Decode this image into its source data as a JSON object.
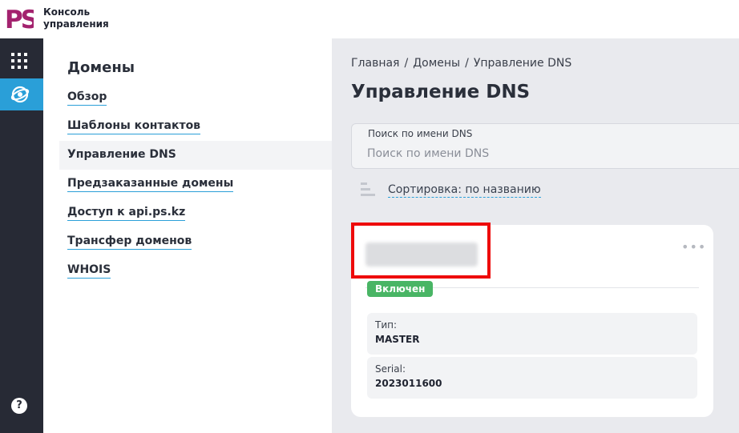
{
  "header": {
    "logo_line1": "Консоль",
    "logo_line2": "управления",
    "logo_mark": "PS",
    "brand_color": "#a3226e"
  },
  "rail": {
    "apps_icon": "grid-icon",
    "active_icon": "globe-icon",
    "help_label": "?",
    "active_color": "#2a9fd8"
  },
  "subnav": {
    "title": "Домены",
    "items": [
      {
        "label": "Обзор",
        "active": false
      },
      {
        "label": "Шаблоны контактов",
        "active": false
      },
      {
        "label": "Управление DNS",
        "active": true
      },
      {
        "label": "Предзаказанные домены",
        "active": false
      },
      {
        "label": "Доступ к api.ps.kz",
        "active": false
      },
      {
        "label": "Трансфер доменов",
        "active": false
      },
      {
        "label": "WHOIS",
        "active": false
      }
    ]
  },
  "main": {
    "breadcrumb": [
      "Главная",
      "Домены",
      "Управление DNS"
    ],
    "breadcrumb_sep": "/",
    "title": "Управление DNS",
    "search": {
      "label": "Поиск по имени DNS",
      "placeholder": "Поиск по имени DNS",
      "value": ""
    },
    "sort": {
      "label": "Сортировка: по названию"
    },
    "card": {
      "name": "",
      "menu": "•••",
      "status": "Включен",
      "status_color": "#49b565",
      "fields": [
        {
          "label": "Тип:",
          "value": "MASTER"
        },
        {
          "label": "Serial:",
          "value": "2023011600"
        }
      ]
    }
  }
}
